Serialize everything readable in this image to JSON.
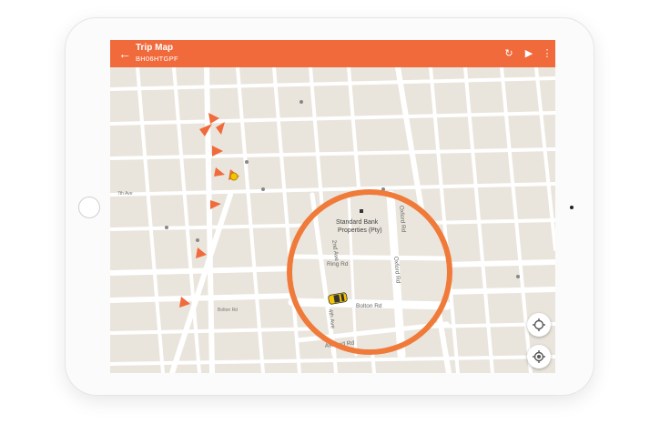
{
  "appbar": {
    "title": "Trip Map",
    "subtitle": "BH06HTGPF",
    "color": "#f06a3b"
  },
  "icons": {
    "back": "arrow-left-icon",
    "refresh": "refresh-icon",
    "play": "play-icon",
    "more": "more-vert-icon",
    "locate": "my-location-icon",
    "center": "gps-fixed-icon"
  },
  "magnifier": {
    "place": "Standard Bank",
    "place_line2": "Properties (Pty)",
    "streets": {
      "oxford_top": "Oxford Rd",
      "oxford_right": "Oxford Rd",
      "ring": "Ring Rd",
      "bolton": "Bolton Rd",
      "ashford": "Ashford Rd",
      "fourth": "4th Ave",
      "second": "2nd Ave"
    },
    "ring_color": "#f07a3a",
    "vehicle_color": "#f5c400"
  },
  "map_labels": {
    "bolton_road": "Bolton Rd",
    "seventh": "7th Ave"
  },
  "route_color": "#f06a3b"
}
